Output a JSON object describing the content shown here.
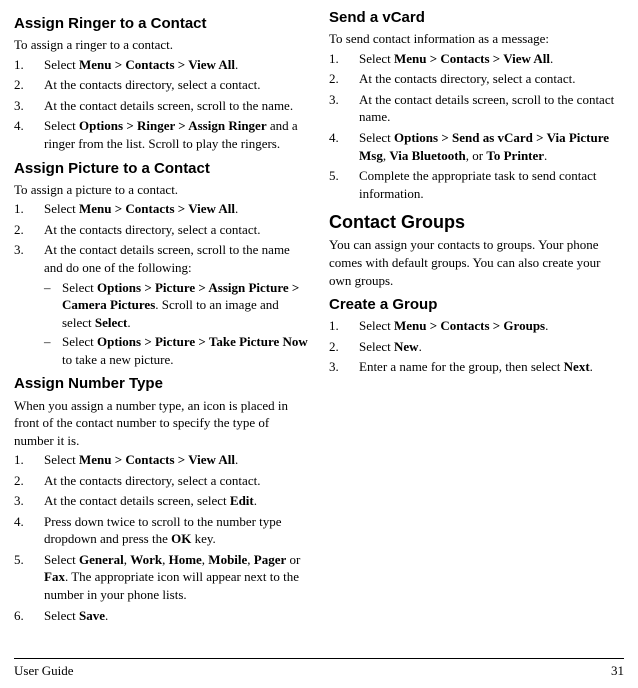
{
  "sections": {
    "ringer": {
      "heading": "Assign Ringer to a Contact",
      "intro": "To assign a ringer to a contact.",
      "step1_pre": "Select ",
      "step1_b": "Menu > Contacts > View All",
      "step1_post": ".",
      "step2": "At the contacts directory, select a contact.",
      "step3": "At the contact details screen, scroll to the name.",
      "step4_pre": "Select ",
      "step4_b": "Options > Ringer > Assign Ringer",
      "step4_post": " and a ringer from the list. Scroll to play the ringers."
    },
    "picture": {
      "heading": "Assign Picture to a Contact",
      "intro": "To assign a picture to a contact.",
      "step1_pre": "Select ",
      "step1_b": "Menu > Contacts > View All",
      "step1_post": ".",
      "step2": "At the contacts directory, select a contact.",
      "step3": "At the contact details screen, scroll to the name and do one of the following:",
      "sub1_pre": "Select ",
      "sub1_b": "Options > Picture > Assign Picture > Camera Pictures",
      "sub1_mid": ". Scroll to an image and select ",
      "sub1_b2": "Select",
      "sub1_post": ".",
      "sub2_pre": "Select ",
      "sub2_b": "Options > Picture > Take Picture Now",
      "sub2_post": " to take a new picture."
    },
    "numtype": {
      "heading": "Assign Number Type",
      "intro": "When you assign a number type, an icon is placed in front of the contact number to specify the type of number it is.",
      "step1_pre": "Select ",
      "step1_b": "Menu > Contacts > View All",
      "step1_post": ".",
      "step2": "At the contacts directory, select a contact.",
      "step3_pre": "At the contact details screen, select ",
      "step3_b": "Edit",
      "step3_post": ".",
      "step4_pre": "Press down twice to scroll to the number type dropdown and press the ",
      "step4_b": "OK",
      "step4_post": " key.",
      "step5_pre": "Select ",
      "step5_b1": "General",
      "step5_s1": ", ",
      "step5_b2": "Work",
      "step5_s2": ", ",
      "step5_b3": "Home",
      "step5_s3": ", ",
      "step5_b4": "Mobile",
      "step5_s4": ", ",
      "step5_b5": "Pager",
      "step5_s5": " or ",
      "step5_b6": "Fax",
      "step5_post": ". The appropriate icon will appear next to the number in your phone lists.",
      "step6_pre": "Select ",
      "step6_b": "Save",
      "step6_post": "."
    },
    "vcard": {
      "heading": "Send a vCard",
      "intro": "To send contact information as a message:",
      "step1_pre": "Select ",
      "step1_b": "Menu > Contacts > View All",
      "step1_post": ".",
      "step2": "At the contacts directory, select a contact.",
      "step3": "At the contact details screen, scroll to the contact name.",
      "step4_pre": "Select ",
      "step4_b1": "Options > Send as vCard > Via Picture Msg",
      "step4_s1": ", ",
      "step4_b2": "Via Bluetooth",
      "step4_s2": ", or ",
      "step4_b3": "To Printer",
      "step4_post": ".",
      "step5": "Complete the appropriate task to send contact information."
    },
    "groups": {
      "heading": "Contact Groups",
      "intro": "You can assign your contacts to groups. Your phone comes with default groups. You can also create your own groups."
    },
    "create": {
      "heading": "Create a Group",
      "step1_pre": "Select ",
      "step1_b": "Menu > Contacts > Groups",
      "step1_post": ".",
      "step2_pre": "Select ",
      "step2_b": "New",
      "step2_post": ".",
      "step3_pre": "Enter a name for the group, then select ",
      "step3_b": "Next",
      "step3_post": "."
    }
  },
  "footer": {
    "left": "User Guide",
    "right": "31"
  },
  "nums": {
    "n1": "1.",
    "n2": "2.",
    "n3": "3.",
    "n4": "4.",
    "n5": "5.",
    "n6": "6.",
    "dash": "–"
  }
}
